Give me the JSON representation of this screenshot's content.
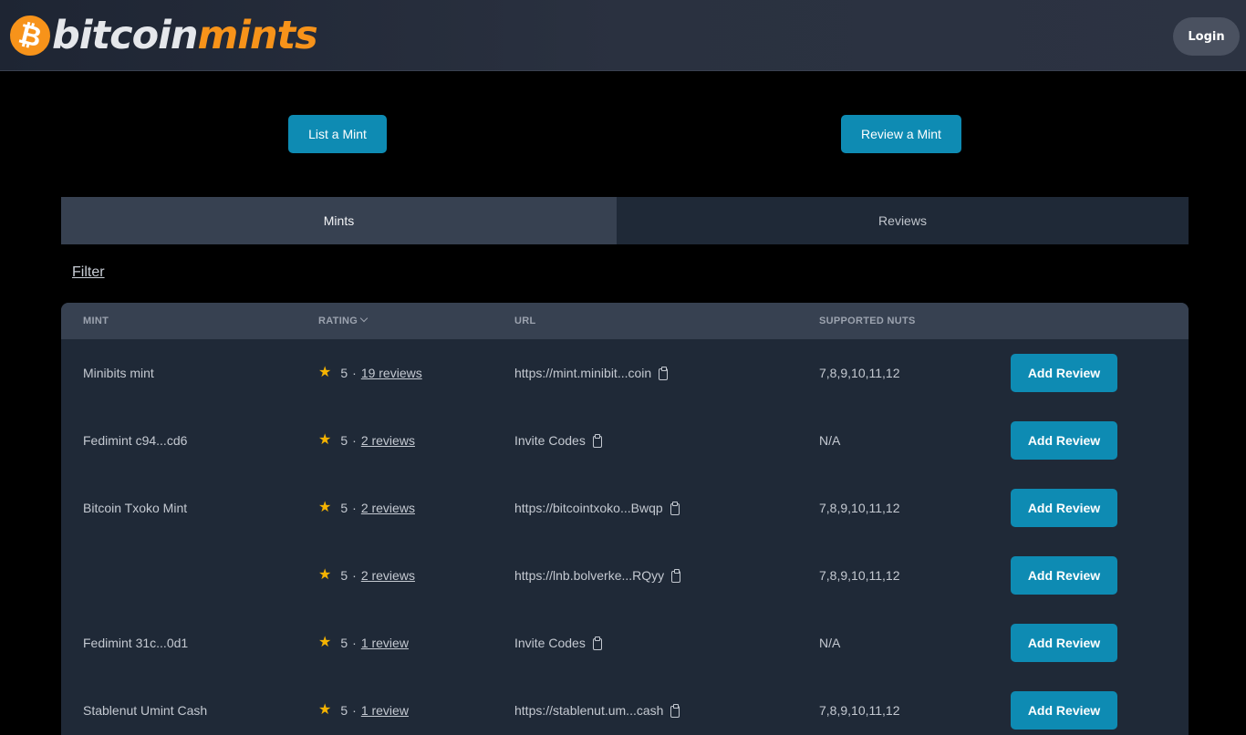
{
  "header": {
    "logo_part1": "bitcoin",
    "logo_part2": "mints",
    "login_label": "Login"
  },
  "actions": {
    "list_label": "List a Mint",
    "review_label": "Review a Mint"
  },
  "tabs": [
    {
      "label": "Mints",
      "active": true
    },
    {
      "label": "Reviews",
      "active": false
    }
  ],
  "filter_label": "Filter",
  "table": {
    "headers": {
      "mint": "MINT",
      "rating": "RATING",
      "url": "URL",
      "nuts": "SUPPORTED NUTS"
    },
    "rows": [
      {
        "name": "Minibits mint",
        "rating": "5",
        "reviews": "19 reviews",
        "url": "https://mint.minibit...coin",
        "nuts": "7,8,9,10,11,12",
        "action": "Add Review"
      },
      {
        "name": "Fedimint c94...cd6",
        "rating": "5",
        "reviews": "2 reviews",
        "url": "Invite Codes",
        "nuts": "N/A",
        "action": "Add Review"
      },
      {
        "name": "Bitcoin Txoko Mint",
        "rating": "5",
        "reviews": "2 reviews",
        "url": "https://bitcointxoko...Bwqp",
        "nuts": "7,8,9,10,11,12",
        "action": "Add Review"
      },
      {
        "name": "",
        "rating": "5",
        "reviews": "2 reviews",
        "url": "https://lnb.bolverke...RQyy",
        "nuts": "7,8,9,10,11,12",
        "action": "Add Review"
      },
      {
        "name": "Fedimint 31c...0d1",
        "rating": "5",
        "reviews": "1 review",
        "url": "Invite Codes",
        "nuts": "N/A",
        "action": "Add Review"
      },
      {
        "name": "Stablenut Umint Cash",
        "rating": "5",
        "reviews": "1 review",
        "url": "https://stablenut.um...cash",
        "nuts": "7,8,9,10,11,12",
        "action": "Add Review"
      }
    ]
  },
  "colors": {
    "accent": "#0e8bb3",
    "brand_orange": "#f7931a",
    "star": "#f5b301"
  }
}
